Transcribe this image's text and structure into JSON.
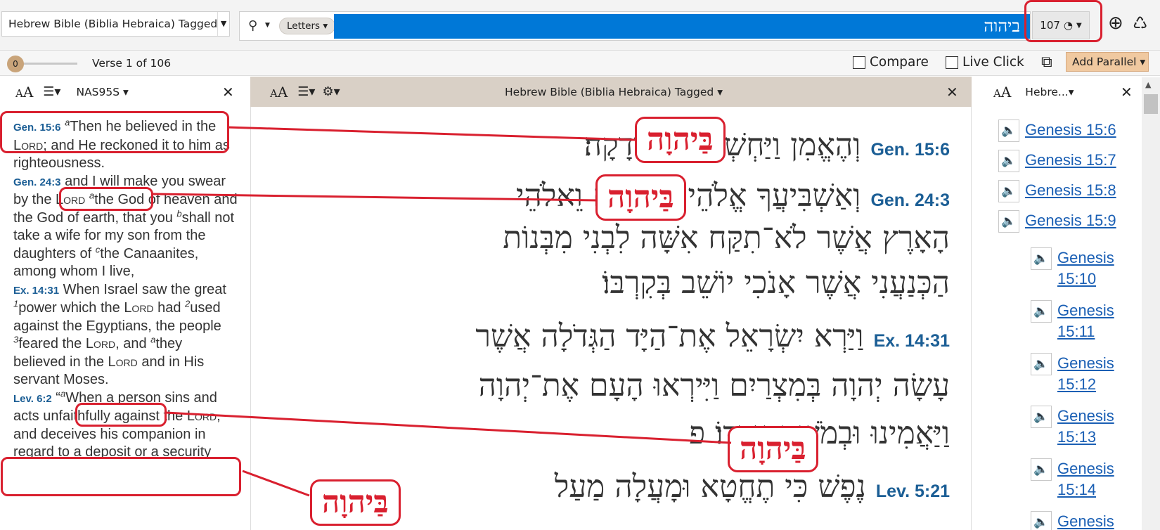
{
  "topbar": {
    "resource_title": "Hebrew Bible (Biblia Hebraica) Tagged",
    "search_mode": "Letters",
    "search_query": "ביהוה",
    "result_count": "107"
  },
  "secondbar": {
    "slider_value": "0",
    "verse_info": "Verse 1 of 106",
    "compare_label": "Compare",
    "live_click_label": "Live Click",
    "add_parallel_label": "Add Parallel"
  },
  "left_panel": {
    "version": "NAS95S",
    "verses": [
      {
        "ref": "Gen. 15:6",
        "text_a": " ",
        "note1": "a",
        "text_b": "Then he believed in the ",
        "lord": "Lord",
        "text_c": "; and He reckoned it to him as righteousness."
      },
      {
        "ref": "Gen. 24:3",
        "text_a": " and I will make you swear by the ",
        "lord": "Lord",
        "note1": "a",
        "text_b": "the God of heaven and the God of earth, that you ",
        "note2": "b",
        "text_c": "shall not take a wife for my son from the daughters of ",
        "note3": "c",
        "text_d": "the Canaanites, among whom I live,"
      },
      {
        "ref": "Ex. 14:31",
        "text_a": " When Israel saw the great ",
        "note1": "1",
        "text_b": "power which the ",
        "lord": "Lord",
        "text_c": " had ",
        "note2": "2",
        "text_d": "used against the Egyptians, the people ",
        "note3": "3",
        "text_e": "feared the ",
        "lord2": "Lord",
        "text_f": ", and ",
        "note4": "a",
        "text_g": "they believed in the ",
        "lord3": "Lord",
        "text_h": " and in His servant Moses."
      },
      {
        "ref": "Lev. 6:2",
        "text_a": " “",
        "note1": "a",
        "text_b": "When a person sins and acts unfaithfully against the ",
        "lord": "Lord",
        "text_c": ", and deceives his companion in regard to a deposit or a security"
      }
    ]
  },
  "mid_panel": {
    "title": "Hebrew Bible (Biblia Hebraica) Tagged",
    "lines": [
      {
        "ref": "Gen. 15:6",
        "text": "וְהֶאֱמִן                 וַיַּחְשְׁבֶהָ לֹּו צְדָקָה׃"
      },
      {
        "ref": "Gen. 24:3",
        "text": "וְאַשְׁבִּיעֲךָ               אֱלֹהֵי הַשָּׁמַיִם וֵאלֹהֵי"
      },
      {
        "ref": "",
        "text": "הָאָרֶץ אֲשֶׁר לֹא־תִקַּח אִשָּׁה לִבְנִי מִבְּנוֹת"
      },
      {
        "ref": "",
        "text": "הַכְּנַעֲנִי אֲשֶׁר אָנֹכִי יוֹשֵׁב בְּקִרְבּוֹ׃"
      },
      {
        "ref": "Ex. 14:31",
        "text": "וַיַּרְא יִשְׂרָאֵל אֶת־הַיָּד הַגְּדֹלָה אֲשֶׁר"
      },
      {
        "ref": "",
        "text": "עָשָׂה יְהוָה בְּמִצְרַיִם וַיִּירְאוּ הָעָם אֶת־יְהוָה"
      },
      {
        "ref": "",
        "text": "וַיַּאֲמִינוּ               וּבְמֹשֶׁה עַבְדּוֹ׃ פ"
      },
      {
        "ref": "Lev. 5:21",
        "text": "נֶפֶשׁ כִּי תֶחֱטָא וּמָעֲלָה מַעַל"
      }
    ],
    "highlight_word": "בַּיהוָה"
  },
  "right_panel": {
    "title": "Hebre...",
    "refs": [
      "Genesis 15:6",
      "Genesis 15:7",
      "Genesis 15:8",
      "Genesis 15:9",
      "Genesis 15:10",
      "Genesis 15:11",
      "Genesis 15:12",
      "Genesis 15:13",
      "Genesis 15:14",
      "Genesis"
    ]
  },
  "icons": {
    "search": "magnifier-icon",
    "add": "plus-circle-icon",
    "sync": "recycle-icon",
    "close": "close-icon",
    "speaker": "speaker-icon"
  },
  "colors": {
    "accent_blue": "#0078d7",
    "annotation_red": "#d9202f",
    "ref_blue": "#1b5e95",
    "link_blue": "#1a5fb4",
    "add_parallel_bg": "#f0c9a0"
  }
}
